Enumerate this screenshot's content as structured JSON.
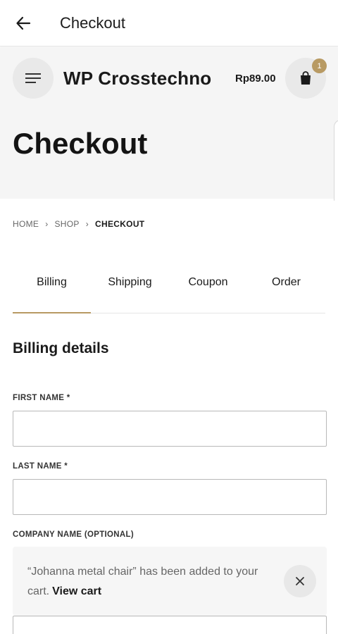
{
  "appbar": {
    "title": "Checkout",
    "back_icon": "arrow-left-icon"
  },
  "header": {
    "site_title": "WP Crosstechno",
    "cart_total": "Rp89.00",
    "cart_count": "1",
    "menu_icon": "menu-icon",
    "cart_icon": "shopping-bag-icon",
    "accent_color": "#b89a63"
  },
  "page": {
    "heading": "Checkout"
  },
  "breadcrumb": {
    "home": "HOME",
    "shop": "SHOP",
    "current": "CHECKOUT"
  },
  "tabs": [
    {
      "label": "Billing",
      "active": true
    },
    {
      "label": "Shipping",
      "active": false
    },
    {
      "label": "Coupon",
      "active": false
    },
    {
      "label": "Order",
      "active": false
    }
  ],
  "billing": {
    "title": "Billing details",
    "first_name_label": "FIRST NAME *",
    "last_name_label": "LAST NAME *",
    "company_label": "COMPANY NAME (OPTIONAL)",
    "first_name_value": "",
    "last_name_value": "",
    "company_value": ""
  },
  "toast": {
    "message": "“Johanna metal chair” has been added to your cart.",
    "link": "View cart",
    "close_icon": "close-icon"
  }
}
